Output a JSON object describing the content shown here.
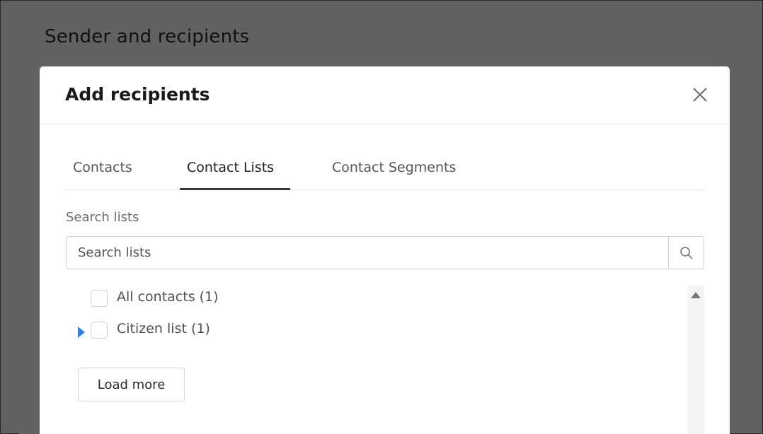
{
  "background": {
    "section_title": "Sender and recipients"
  },
  "modal": {
    "title": "Add recipients",
    "close_icon": "close-icon",
    "tabs": [
      {
        "label": "Contacts",
        "active": false
      },
      {
        "label": "Contact Lists",
        "active": true
      },
      {
        "label": "Contact Segments",
        "active": false
      }
    ],
    "search": {
      "label": "Search lists",
      "placeholder": "Search lists",
      "value": "",
      "icon": "search-icon"
    },
    "lists": [
      {
        "label": "All contacts (1)",
        "checked": false,
        "expandable": false
      },
      {
        "label": "Citizen list (1)",
        "checked": false,
        "expandable": true
      }
    ],
    "load_more_label": "Load more"
  },
  "colors": {
    "overlay": "#606060",
    "accent_arrow": "#2f7fe0",
    "tab_underline": "#333a45"
  }
}
